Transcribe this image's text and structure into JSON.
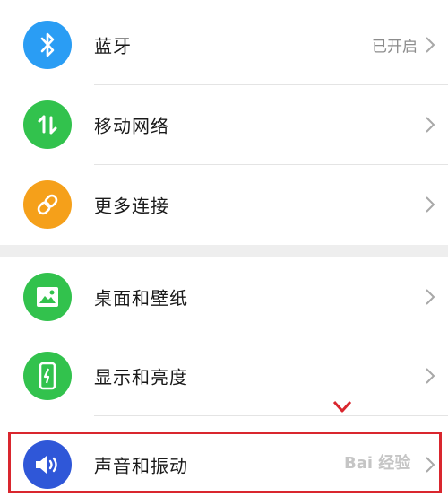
{
  "settings": {
    "bluetooth": {
      "label": "蓝牙",
      "value": "已开启",
      "icon": "bluetooth-icon",
      "icon_color": "#2a9df4"
    },
    "mobile_network": {
      "label": "移动网络",
      "icon": "mobile-data-icon",
      "icon_color": "#32c24d"
    },
    "more_connections": {
      "label": "更多连接",
      "icon": "link-icon",
      "icon_color": "#f5a01a"
    },
    "wallpaper": {
      "label": "桌面和壁纸",
      "icon": "image-icon",
      "icon_color": "#32c24d"
    },
    "display": {
      "label": "显示和亮度",
      "icon": "phone-brightness-icon",
      "icon_color": "#32c24d"
    },
    "sound": {
      "label": "声音和振动",
      "icon": "speaker-icon",
      "icon_color": "#2f57d8"
    }
  },
  "annotation": {
    "highlight_color": "#d9262e"
  },
  "watermark": {
    "text": "Bai 经验"
  }
}
